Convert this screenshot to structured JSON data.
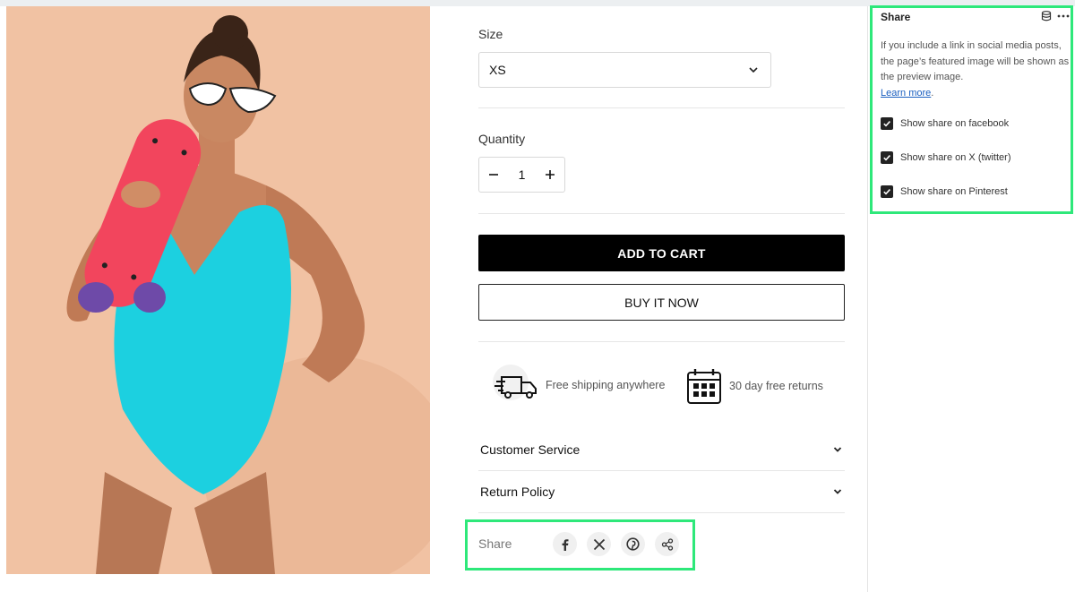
{
  "product": {
    "size_label": "Size",
    "size_value": "XS",
    "quantity_label": "Quantity",
    "quantity_value": "1",
    "add_to_cart": "ADD TO CART",
    "buy_now": "BUY IT NOW",
    "features": [
      {
        "icon": "delivery-truck-icon",
        "label": "Free shipping anywhere"
      },
      {
        "icon": "calendar-icon",
        "label": "30 day free returns"
      }
    ],
    "accordions": [
      {
        "label": "Customer Service"
      },
      {
        "label": "Return Policy"
      }
    ],
    "share": {
      "label": "Share",
      "icons": [
        "facebook-icon",
        "x-twitter-icon",
        "pinterest-icon",
        "share-link-icon"
      ]
    }
  },
  "settings_panel": {
    "title": "Share",
    "description": "If you include a link in social media posts, the page’s featured image will be shown as the preview image.",
    "learn_more": "Learn more",
    "options": [
      {
        "label": "Show share on facebook",
        "checked": true
      },
      {
        "label": "Show share on X (twitter)",
        "checked": true
      },
      {
        "label": "Show share on Pinterest",
        "checked": true
      }
    ],
    "header_icons": [
      "database-icon",
      "more-options-icon"
    ]
  },
  "colors": {
    "highlight": "#2ee87a",
    "primary_button": "#000000",
    "link": "#1a5fc0",
    "photo_background": "#f1c2a3"
  }
}
